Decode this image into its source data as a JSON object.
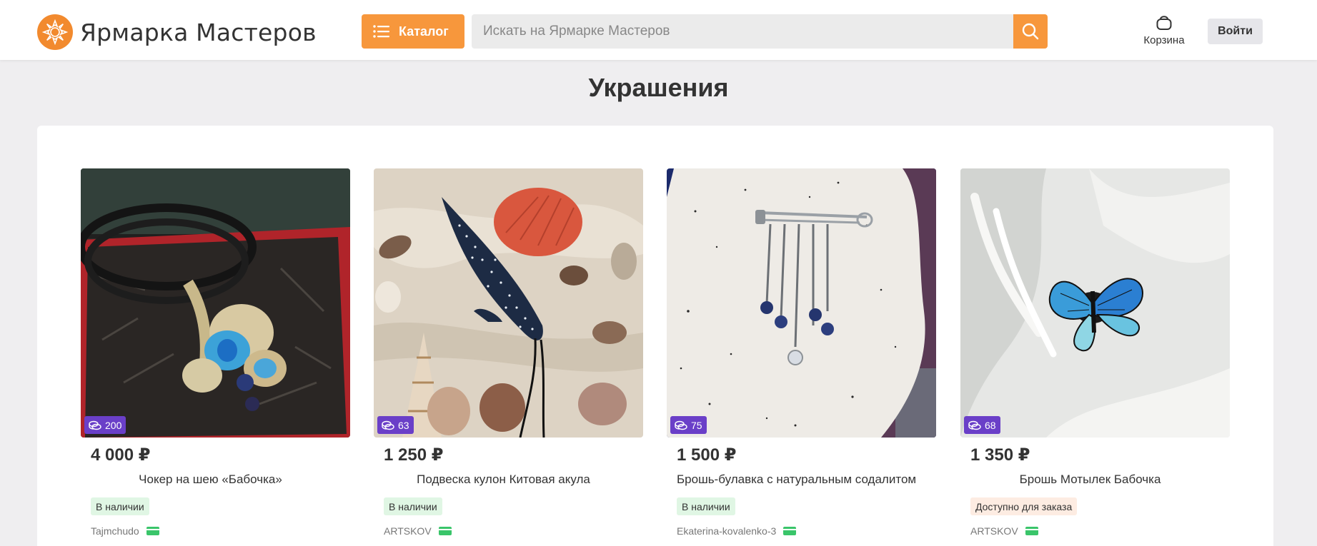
{
  "header": {
    "logo_text": "Ярмарка Мастеров",
    "catalog_label": "Каталог",
    "search_placeholder": "Искать на Ярмарке Мастеров",
    "cart_label": "Корзина",
    "login_label": "Войти"
  },
  "page": {
    "title": "Украшения"
  },
  "products": [
    {
      "price": "4 000 ₽",
      "title": "Чокер на шею «Бабочка»",
      "status": "В наличии",
      "seller": "Tajmchudo",
      "coins": "200"
    },
    {
      "price": "1 250 ₽",
      "title": "Подвеска кулон Китовая акула",
      "status": "В наличии",
      "seller": "ARTSKOV",
      "coins": "63"
    },
    {
      "price": "1 500 ₽",
      "title": "Брошь-булавка с натуральным содалитом",
      "status": "В наличии",
      "seller": "Ekaterina-kovalenko-3",
      "coins": "75"
    },
    {
      "price": "1 350 ₽",
      "title": "Брошь Мотылек Бабочка",
      "status": "Доступно для заказа",
      "seller": "ARTSKOV",
      "coins": "68"
    }
  ],
  "colors": {
    "accent": "#f7973c",
    "badge": "#6a3fc8",
    "in_stock_bg": "#e0f6e4",
    "order_bg": "#fdece2",
    "seller_icon": "#3ac56a"
  },
  "icons": {
    "logo": "sun-logo-icon",
    "catalog": "menu-list-icon",
    "search": "search-icon",
    "cart": "basket-icon",
    "coins": "coins-icon",
    "seller": "card-icon"
  }
}
